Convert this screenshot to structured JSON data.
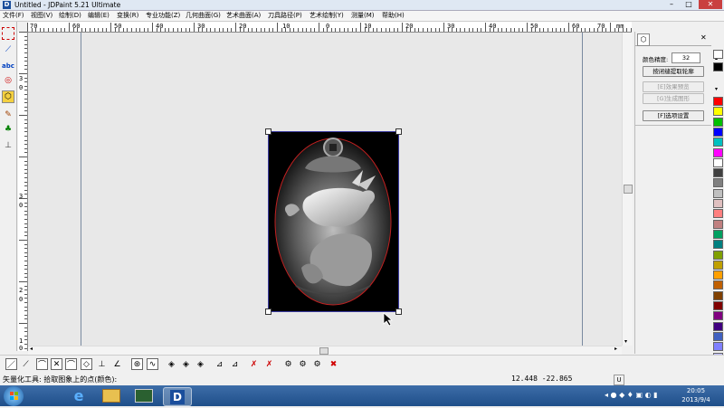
{
  "window": {
    "title": "Untitled - JDPaint 5.21 Ultimate",
    "min": "–",
    "max": "□",
    "close": "✕"
  },
  "menu": [
    "文件(F)",
    "视图(V)",
    "绘制(D)",
    "编辑(E)",
    "变换(R)",
    "专业功能(Z)",
    "几何曲面(G)",
    "艺术曲面(A)",
    "刀具路径(P)",
    "艺术绘制(Y)",
    "测量(M)",
    "帮助(H)"
  ],
  "ruler": {
    "h_labels": [
      "70",
      "60",
      "50",
      "40",
      "30",
      "20",
      "10",
      "0",
      "10",
      "20",
      "30",
      "40",
      "50",
      "60",
      "70"
    ],
    "unit": "mm",
    "v_labels": [
      "3",
      "0",
      "3",
      "0",
      "2",
      "0",
      "1",
      "0"
    ]
  },
  "panel": {
    "color_precision_label": "颜色精度:",
    "color_precision_value": "32",
    "btn_color_contour": "按闭缝提取轮廓",
    "btn_effect_preview": "[E]效果预览",
    "btn_generate_shape": "[G]生成图形",
    "btn_options": "[F]选项设置"
  },
  "palette_colors": [
    "#ffffff",
    "#000000",
    "#ff0000",
    "#ffff00",
    "#00c000",
    "#0000ff",
    "#00c0c0",
    "#ff00ff",
    "#ffffff",
    "#404040",
    "#808080",
    "#c0c0c0",
    "#e0c0c0",
    "#ff8080",
    "#c08080",
    "#00a060",
    "#008080",
    "#80a000",
    "#c0a000",
    "#ffa000",
    "#c06000",
    "#804000",
    "#800000",
    "#800080",
    "#400080",
    "#4060c0",
    "#8080ff",
    "#c0c0ff",
    "#a0a0a0"
  ],
  "status": {
    "message": "矢量化工具: 拾取图象上的点(颜色):",
    "coords": "12.448   -22.865",
    "mode": "U"
  },
  "taskbar": {
    "time": "20:05",
    "date": "2013/9/4"
  }
}
